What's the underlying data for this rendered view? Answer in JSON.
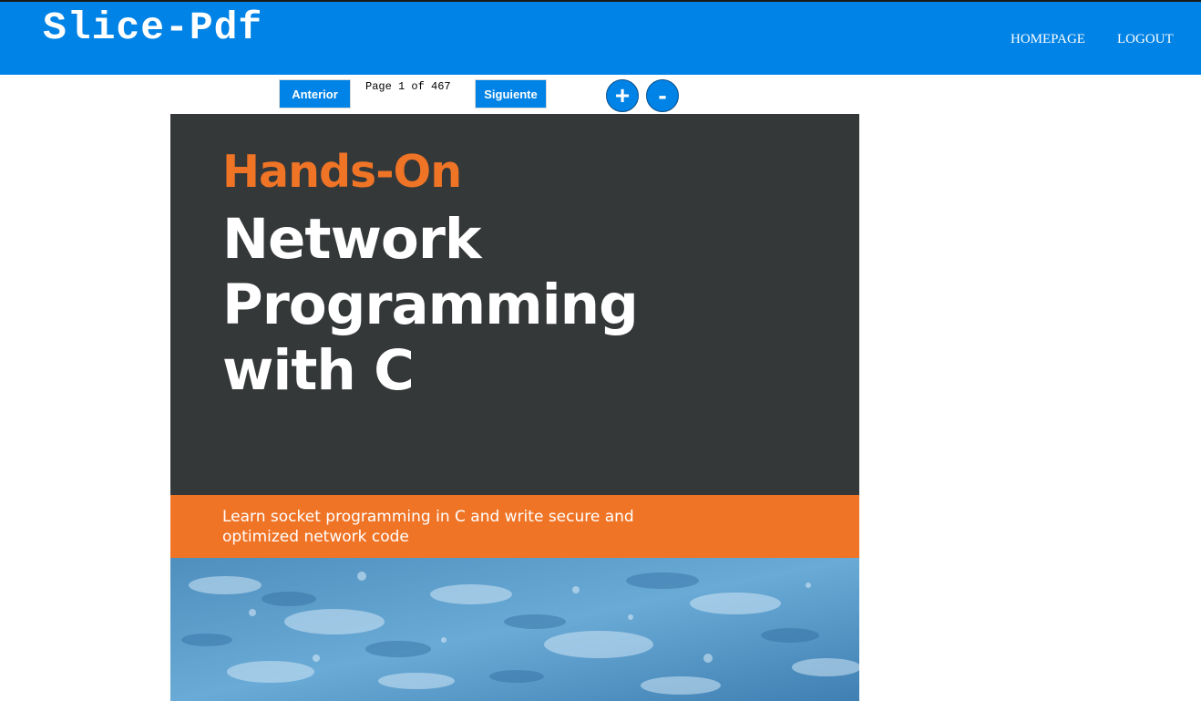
{
  "app": {
    "title": "Slice-Pdf"
  },
  "nav": {
    "homepage": "HOMEPAGE",
    "logout": "LOGOUT"
  },
  "viewer": {
    "prev_label": "Anterior",
    "next_label": "Siguiente",
    "page_indicator": "Page 1 of 467",
    "zoom_in_label": "+",
    "zoom_out_label": "-"
  },
  "document": {
    "cover": {
      "kicker": "Hands-On",
      "title_lines": [
        "Network",
        "Programming",
        "with C"
      ],
      "subtitle_lines": [
        "Learn socket programming in C and write secure and",
        "optimized network code"
      ]
    }
  },
  "colors": {
    "header_bg": "#0083e6",
    "cover_dark": "#353839",
    "cover_orange": "#f07426",
    "ice_blue": "#5a9bc8"
  }
}
